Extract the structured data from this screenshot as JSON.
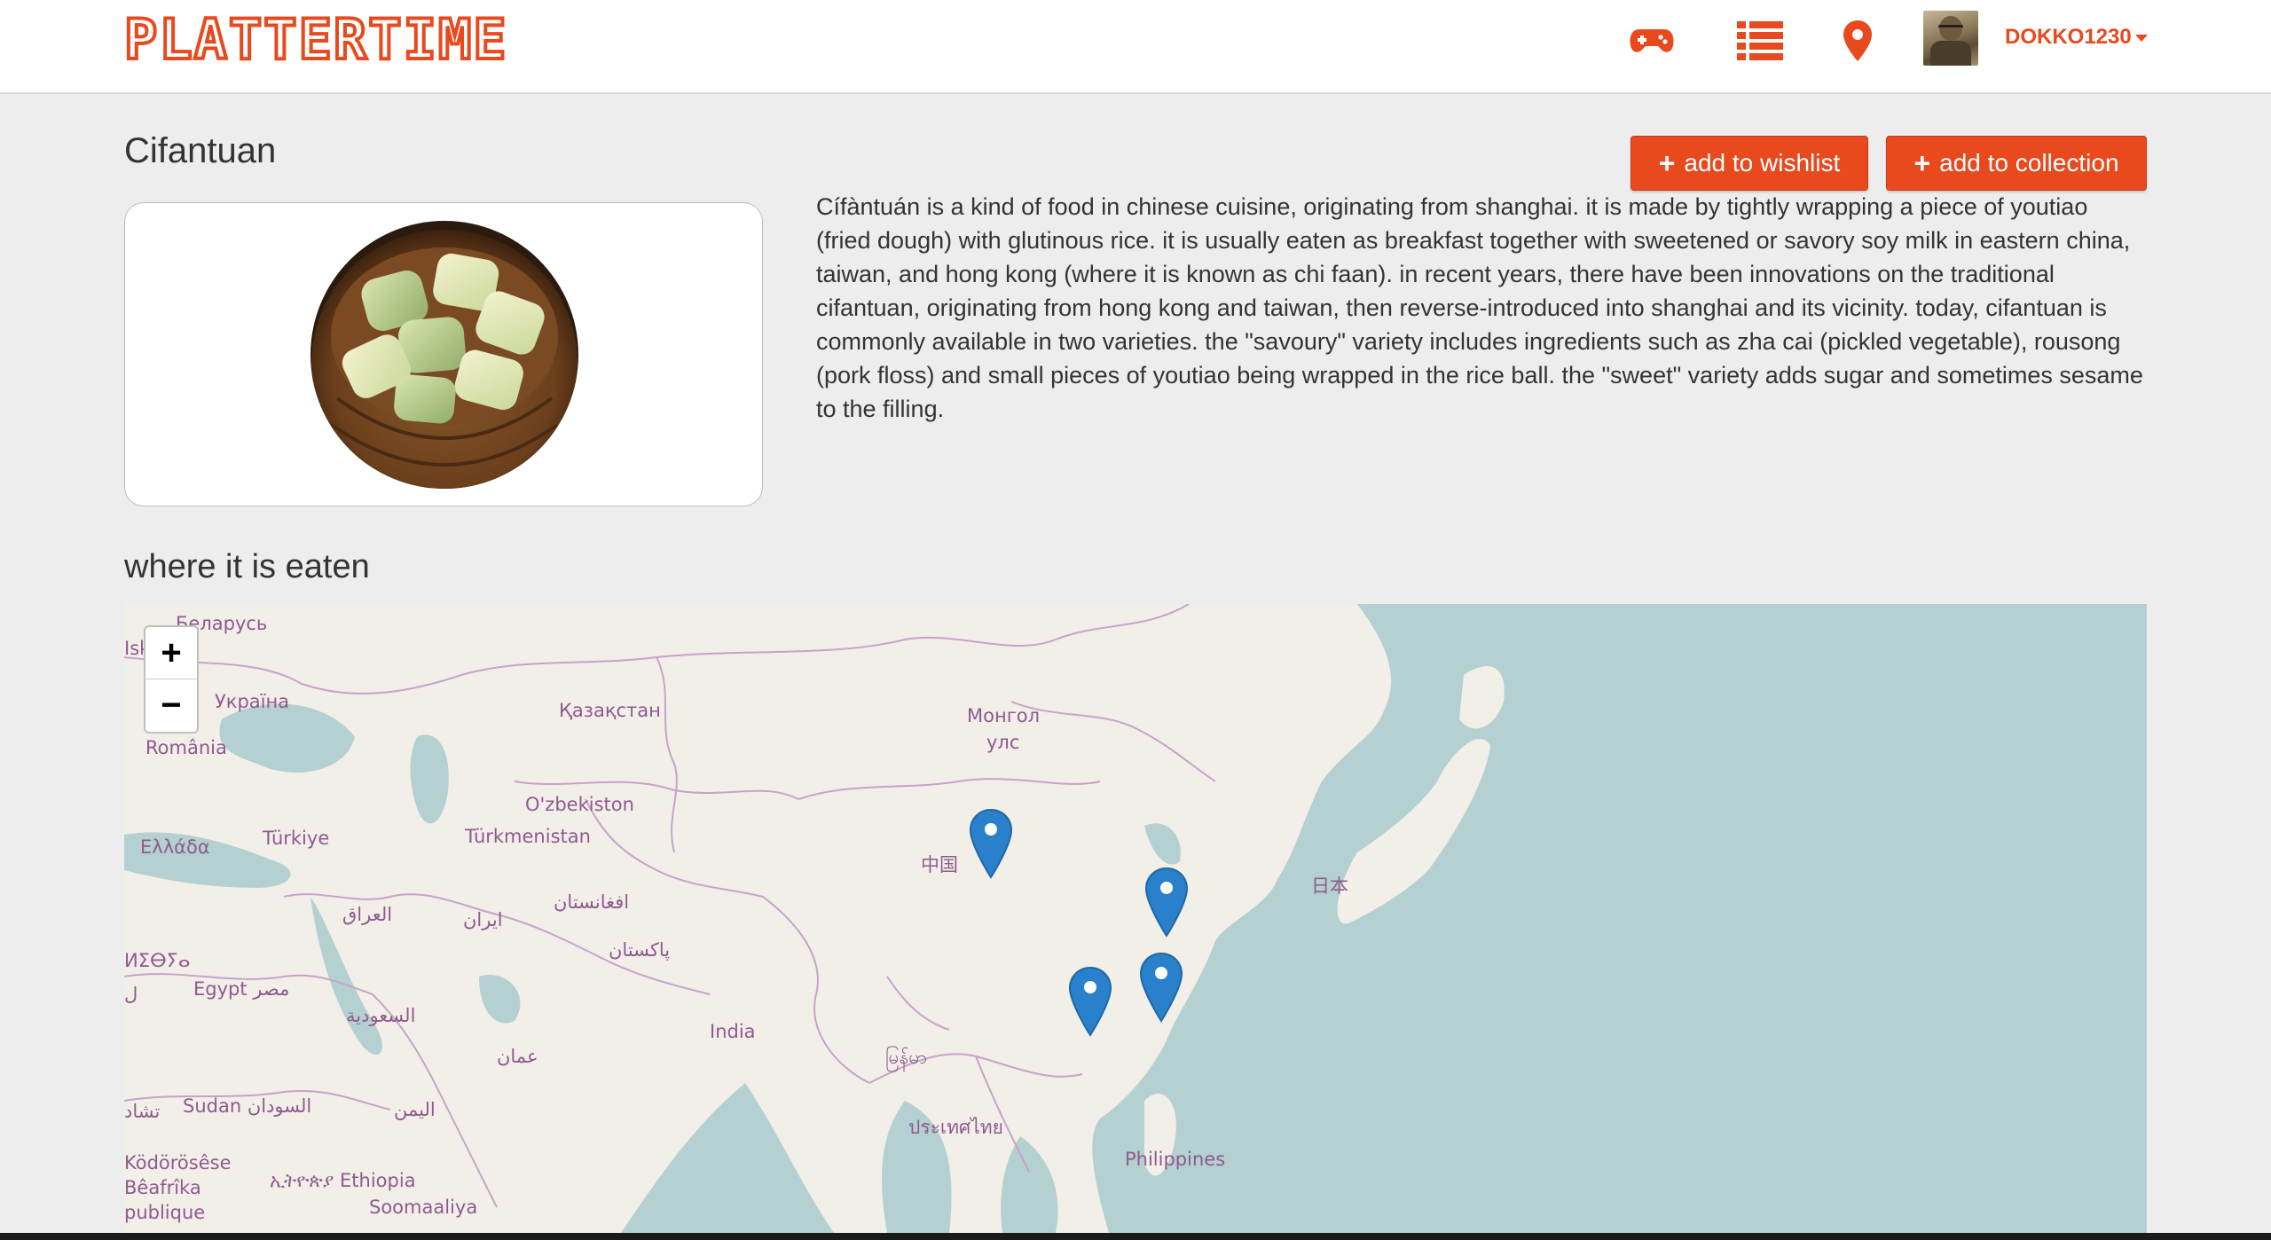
{
  "header": {
    "brand": "PLATTERTIME",
    "username": "DOKKO1230",
    "icons": [
      "gamepad-icon",
      "list-icon",
      "map-marker-icon"
    ]
  },
  "food": {
    "title": "Cifantuan",
    "description": "Cífàntuán is a kind of food in chinese cuisine, originating from shanghai. it is made by tightly wrapping a piece of youtiao (fried dough) with glutinous rice. it is usually eaten as breakfast together with sweetened or savory soy milk in eastern china, taiwan, and hong kong (where it is known as chi faan). in recent years, there have been innovations on the traditional cifantuan, originating from hong kong and taiwan, then reverse-introduced into shanghai and its vicinity. today, cifantuan is commonly available in two varieties. the \"savoury\" variety includes ingredients such as zha cai (pickled vegetable), rousong (pork floss) and small pieces of youtiao being wrapped in the rice ball. the \"sweet\" variety adds sugar and sometimes sesame to the filling."
  },
  "actions": {
    "wishlist_label": "add to wishlist",
    "collection_label": "add to collection",
    "plus": "+"
  },
  "map_section": {
    "heading": "where it is eaten",
    "zoom_in": "+",
    "zoom_out": "−",
    "labels": {
      "belarus": "Беларусь",
      "isk": "Isk",
      "ukraine": "Україна",
      "kazakhstan": "Қазақстан",
      "mongolia1": "Монгол",
      "mongolia2": "улс",
      "romania": "România",
      "uzbekistan": "O'zbekiston",
      "turkey": "Türkiye",
      "turkmenistan": "Türkmenistan",
      "greece": "Ελλάδα",
      "china": "中国",
      "japan": "日本",
      "iraq": "العراق",
      "iran": "ایران",
      "afghanistan": "افغانستان",
      "pakistan": "پاکستان",
      "libya": "ⵍⵉⴱⵢⴰ",
      "l": "ل",
      "egypt": "Egypt مصر",
      "saudi": "السعودية",
      "india": "India",
      "oman": "عمان",
      "myanmar": "မြန်မာ",
      "chad": "تشاد",
      "sudan": "Sudan السودان",
      "yemen": "اليمن",
      "thailand": "ประเทศไทย",
      "philippines": "Philippines",
      "centrafrique1": "Ködörösêse",
      "centrafrique2": "Bêafrîka",
      "centrafrique3": "publique",
      "ethiopia": "ኢትዮጵያ Ethiopia",
      "somalia": "Soomaaliya"
    }
  },
  "colors": {
    "accent": "#e8491d",
    "map_sea": "#b5d0d0",
    "map_land": "#f2efe9",
    "marker": "#2a81cb"
  }
}
